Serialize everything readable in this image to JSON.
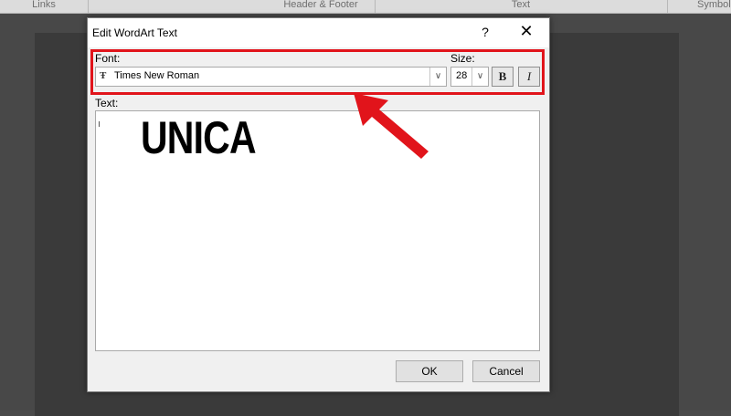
{
  "ribbon": {
    "groups": [
      "Links",
      "Header & Footer",
      "Text",
      "Symbol"
    ]
  },
  "dialog": {
    "title": "Edit WordArt Text",
    "help_label": "?",
    "close_label": "✕",
    "font_label": "Font:",
    "font_value": "Times New Roman",
    "size_label": "Size:",
    "size_value": "28",
    "bold_label": "B",
    "italic_label": "I",
    "text_label": "Text:",
    "text_value": "UNICA",
    "ok_label": "OK",
    "cancel_label": "Cancel"
  },
  "annotation": {
    "highlight_color": "#e1141b"
  }
}
